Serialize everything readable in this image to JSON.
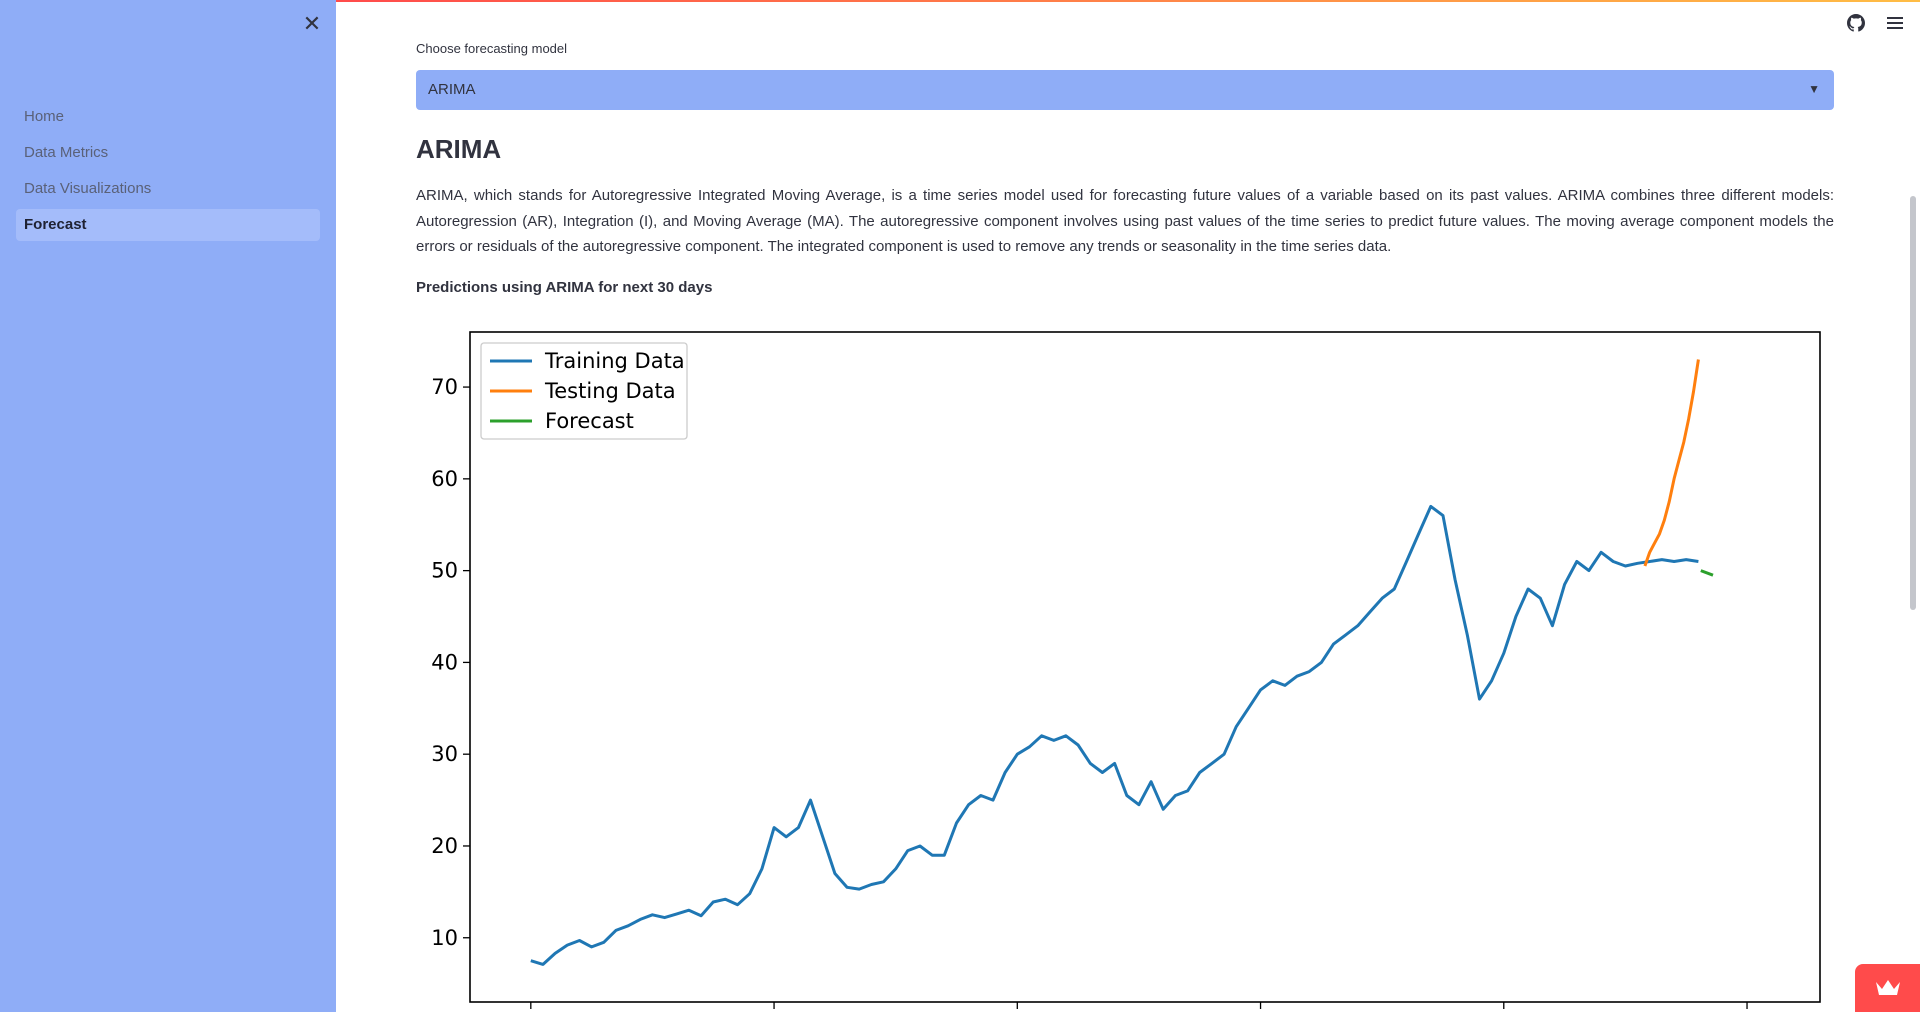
{
  "sidebar": {
    "close_icon": "close-icon",
    "items": [
      {
        "label": "Home",
        "active": false
      },
      {
        "label": "Data Metrics",
        "active": false
      },
      {
        "label": "Data Visualizations",
        "active": false
      },
      {
        "label": "Forecast",
        "active": true
      }
    ]
  },
  "toolbar": {
    "github_icon": "github-icon",
    "menu_icon": "hamburger-menu-icon"
  },
  "main": {
    "select_label": "Choose forecasting model",
    "select_value": "ARIMA",
    "heading": "ARIMA",
    "paragraph": "ARIMA, which stands for Autoregressive Integrated Moving Average, is a time series model used for forecasting future values of a variable based on its past values. ARIMA combines three different models: Autoregression (AR), Integration (I), and Moving Average (MA). The autoregressive component involves using past values of the time series to predict future values. The moving average component models the errors or residuals of the autoregressive component. The integrated component is used to remove any trends or seasonality in the time series data.",
    "caption": "Predictions using ARIMA for next 30 days"
  },
  "colors": {
    "sidebar": "#8fadf7",
    "training": "#1f77b4",
    "testing": "#ff7f0e",
    "forecast": "#2ca02c",
    "badge": "#ff4b4b"
  },
  "chart_data": {
    "type": "line",
    "title": "",
    "xlabel": "",
    "ylabel": "",
    "ylim": [
      3,
      76
    ],
    "xlim": [
      -25,
      530
    ],
    "yticks": [
      10,
      20,
      30,
      40,
      50,
      60,
      70
    ],
    "grid": false,
    "legend": "top-left",
    "series": [
      {
        "name": "Training Data",
        "color": "#1f77b4",
        "x": [
          0,
          5,
          10,
          15,
          20,
          25,
          30,
          35,
          40,
          45,
          50,
          55,
          60,
          65,
          70,
          75,
          80,
          85,
          90,
          95,
          100,
          105,
          110,
          115,
          120,
          125,
          130,
          135,
          140,
          145,
          150,
          155,
          160,
          165,
          170,
          175,
          180,
          185,
          190,
          195,
          200,
          205,
          210,
          215,
          220,
          225,
          230,
          235,
          240,
          245,
          250,
          255,
          260,
          265,
          270,
          275,
          280,
          285,
          290,
          295,
          300,
          305,
          310,
          315,
          320,
          325,
          330,
          335,
          340,
          345,
          350,
          355,
          360,
          365,
          370,
          375,
          380,
          385,
          390,
          395,
          400,
          405,
          410,
          415,
          420,
          425,
          430,
          435,
          440,
          445,
          450,
          455,
          460,
          465,
          470,
          475,
          480
        ],
        "y": [
          7.5,
          7.1,
          8.3,
          9.2,
          9.7,
          9.0,
          9.5,
          10.8,
          11.3,
          12.0,
          12.5,
          12.2,
          12.6,
          13.0,
          12.4,
          13.9,
          14.2,
          13.6,
          14.8,
          17.5,
          22.0,
          21.0,
          22.0,
          25.0,
          21.0,
          17.0,
          15.5,
          15.3,
          15.8,
          16.1,
          17.5,
          19.5,
          20.0,
          19.0,
          19.0,
          22.5,
          24.5,
          25.5,
          25.0,
          28.0,
          30.0,
          30.8,
          32.0,
          31.5,
          32.0,
          31.0,
          29.0,
          28.0,
          29.0,
          25.5,
          24.5,
          27.0,
          24.0,
          25.5,
          26.0,
          28.0,
          29.0,
          30.0,
          33.0,
          35.0,
          37.0,
          38.0,
          37.5,
          38.5,
          39.0,
          40.0,
          42.0,
          43.0,
          44.0,
          45.5,
          47.0,
          48.0,
          51.0,
          54.0,
          57.0,
          56.0,
          49.0,
          43.0,
          36.0,
          38.0,
          41.0,
          45.0,
          48.0,
          47.0,
          44.0,
          48.5,
          51.0,
          50.0,
          52.0,
          51.0,
          50.5,
          50.8,
          51.0,
          51.2,
          51.0,
          51.2,
          51.0
        ]
      },
      {
        "name": "Testing Data",
        "color": "#ff7f0e",
        "x": [
          458,
          460,
          462,
          464,
          466,
          468,
          470,
          472,
          474,
          476,
          478,
          480
        ],
        "y": [
          50.5,
          52.0,
          53.0,
          54.0,
          55.5,
          57.5,
          60.0,
          62.0,
          64.0,
          66.5,
          69.5,
          73.0
        ]
      },
      {
        "name": "Forecast",
        "color": "#2ca02c",
        "x": [
          481,
          486
        ],
        "y": [
          50.0,
          49.5
        ]
      }
    ]
  }
}
